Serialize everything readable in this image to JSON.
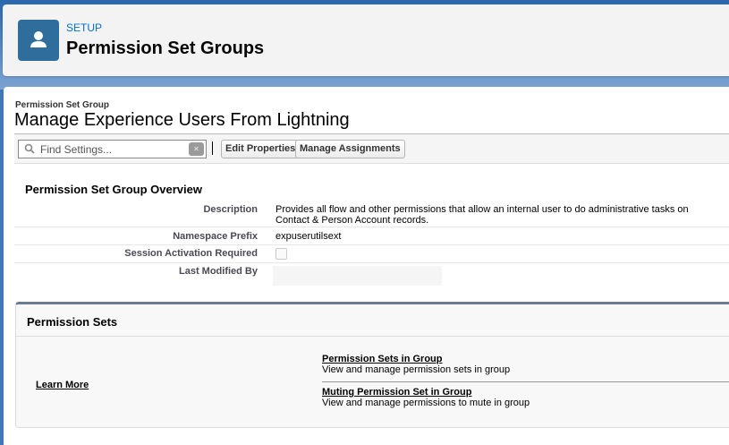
{
  "header": {
    "eyebrow": "SETUP",
    "title": "Permission Set Groups",
    "icon": "user-icon"
  },
  "page": {
    "pretitle": "Permission Set Group",
    "title": "Manage Experience Users From Lightning"
  },
  "toolbar": {
    "search_placeholder": "Find Settings...",
    "edit_label": "Edit Properties",
    "assign_label": "Manage Assignments"
  },
  "overview": {
    "heading": "Permission Set Group Overview",
    "fields": [
      {
        "label": "Description",
        "value": "Provides all flow and other permissions that allow an internal user to do administrative tasks on Contact & Person Account records."
      },
      {
        "label": "Namespace Prefix",
        "value": "expuserutilsext"
      },
      {
        "label": "Session Activation Required",
        "checked": false
      },
      {
        "label": "Last Modified By",
        "value": ""
      }
    ]
  },
  "permission_sets": {
    "heading": "Permission Sets",
    "learn_more": "Learn More",
    "links": [
      {
        "title": "Permission Sets in Group",
        "desc": "View and manage permission sets in group"
      },
      {
        "title": "Muting Permission Set in Group",
        "desc": "View and manage permissions to mute in group"
      }
    ]
  }
}
